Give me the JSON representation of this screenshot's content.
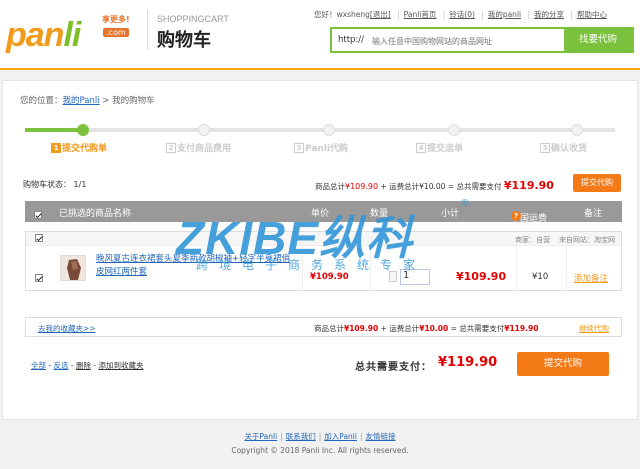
{
  "header": {
    "logo": {
      "brand": "panli",
      "tagline": "享更多!",
      "domain": ".com"
    },
    "title_en": "SHOPPINGCART",
    "title_cn": "购物车",
    "top_links": {
      "greeting": "您好！",
      "username": "wxsheng",
      "logout": "[退出]",
      "home": "Panli首页",
      "notice": "铃话(0)",
      "my_panli": "我的panli",
      "my_share": "我的分享",
      "help": "帮助中心"
    },
    "search": {
      "prefix": "http://",
      "placeholder": "输入任意中国购物网站的商品网址",
      "button": "找要代购"
    }
  },
  "breadcrumb": {
    "prefix": "您的位置：",
    "link": "我的Panli",
    "sep": ">",
    "current": "我的购物车"
  },
  "steps": [
    {
      "num": "1",
      "label": "提交代购单"
    },
    {
      "num": "2",
      "label": "支付商品费用"
    },
    {
      "num": "3",
      "label": "Panli代购"
    },
    {
      "num": "4",
      "label": "提交运单"
    },
    {
      "num": "5",
      "label": "确认收货"
    }
  ],
  "progress": {
    "completed_steps": 1,
    "total_steps": 5
  },
  "cart": {
    "status_label": "购物车状态：",
    "status_value": "1/1",
    "total_line": {
      "goods_label": "商品总计",
      "goods": "¥109.90",
      "shipping_label": "+ 运费总计",
      "shipping": "¥10.00",
      "total_label": "= 总共需要支付",
      "total": "¥119.90"
    },
    "submit": "提交代购"
  },
  "table_header": {
    "selected_name": "已挑选的商品名称",
    "price": "单价",
    "qty": "数量",
    "subtotal": "小计",
    "cn_shipping": "中国运费",
    "cn_shipping_help": "?",
    "remark": "备注"
  },
  "item_store": {
    "store_label": "商家：",
    "store": "自营",
    "source_label": "来自网站：",
    "source": "淘宝网"
  },
  "items": [
    {
      "name": "晚风夏古连衣裙套头夏季新款胡椒袖+轻字半身裙俏皮网红两件套",
      "price": "¥109.90",
      "qty": "1",
      "subtotal": "¥109.90",
      "shipping": "¥10",
      "remark": "添加备注"
    }
  ],
  "summary": {
    "fav_link": "去我的收藏夹>>",
    "goods_label": "商品总计",
    "goods": "¥109.90",
    "shipping_label": "+ 运费总计",
    "shipping": "¥10.00",
    "total_label": "= 总共需要支付",
    "total": "¥119.90",
    "continue": "继续代购"
  },
  "bulk": {
    "select_all": "全部",
    "invert": "反选",
    "delete": "删除",
    "add_fav": "添加到收藏夹"
  },
  "grand": {
    "label": "总共需要支付：",
    "total": "¥119.90",
    "submit": "提交代购"
  },
  "footer": {
    "links": [
      "关于Panli",
      "联系我们",
      "加入Panli",
      "友情链接"
    ],
    "copyright": "Copyright © 2018 Panli Inc. All rights reserved."
  },
  "watermark": {
    "main": "ZKIBE纵科",
    "sub": "跨境电子商务系统专家",
    "reg": "®"
  },
  "colors": {
    "accent_orange": "#f37a17",
    "accent_green": "#7cc13e",
    "price_red": "#e30000",
    "link_blue": "#2266bb"
  }
}
